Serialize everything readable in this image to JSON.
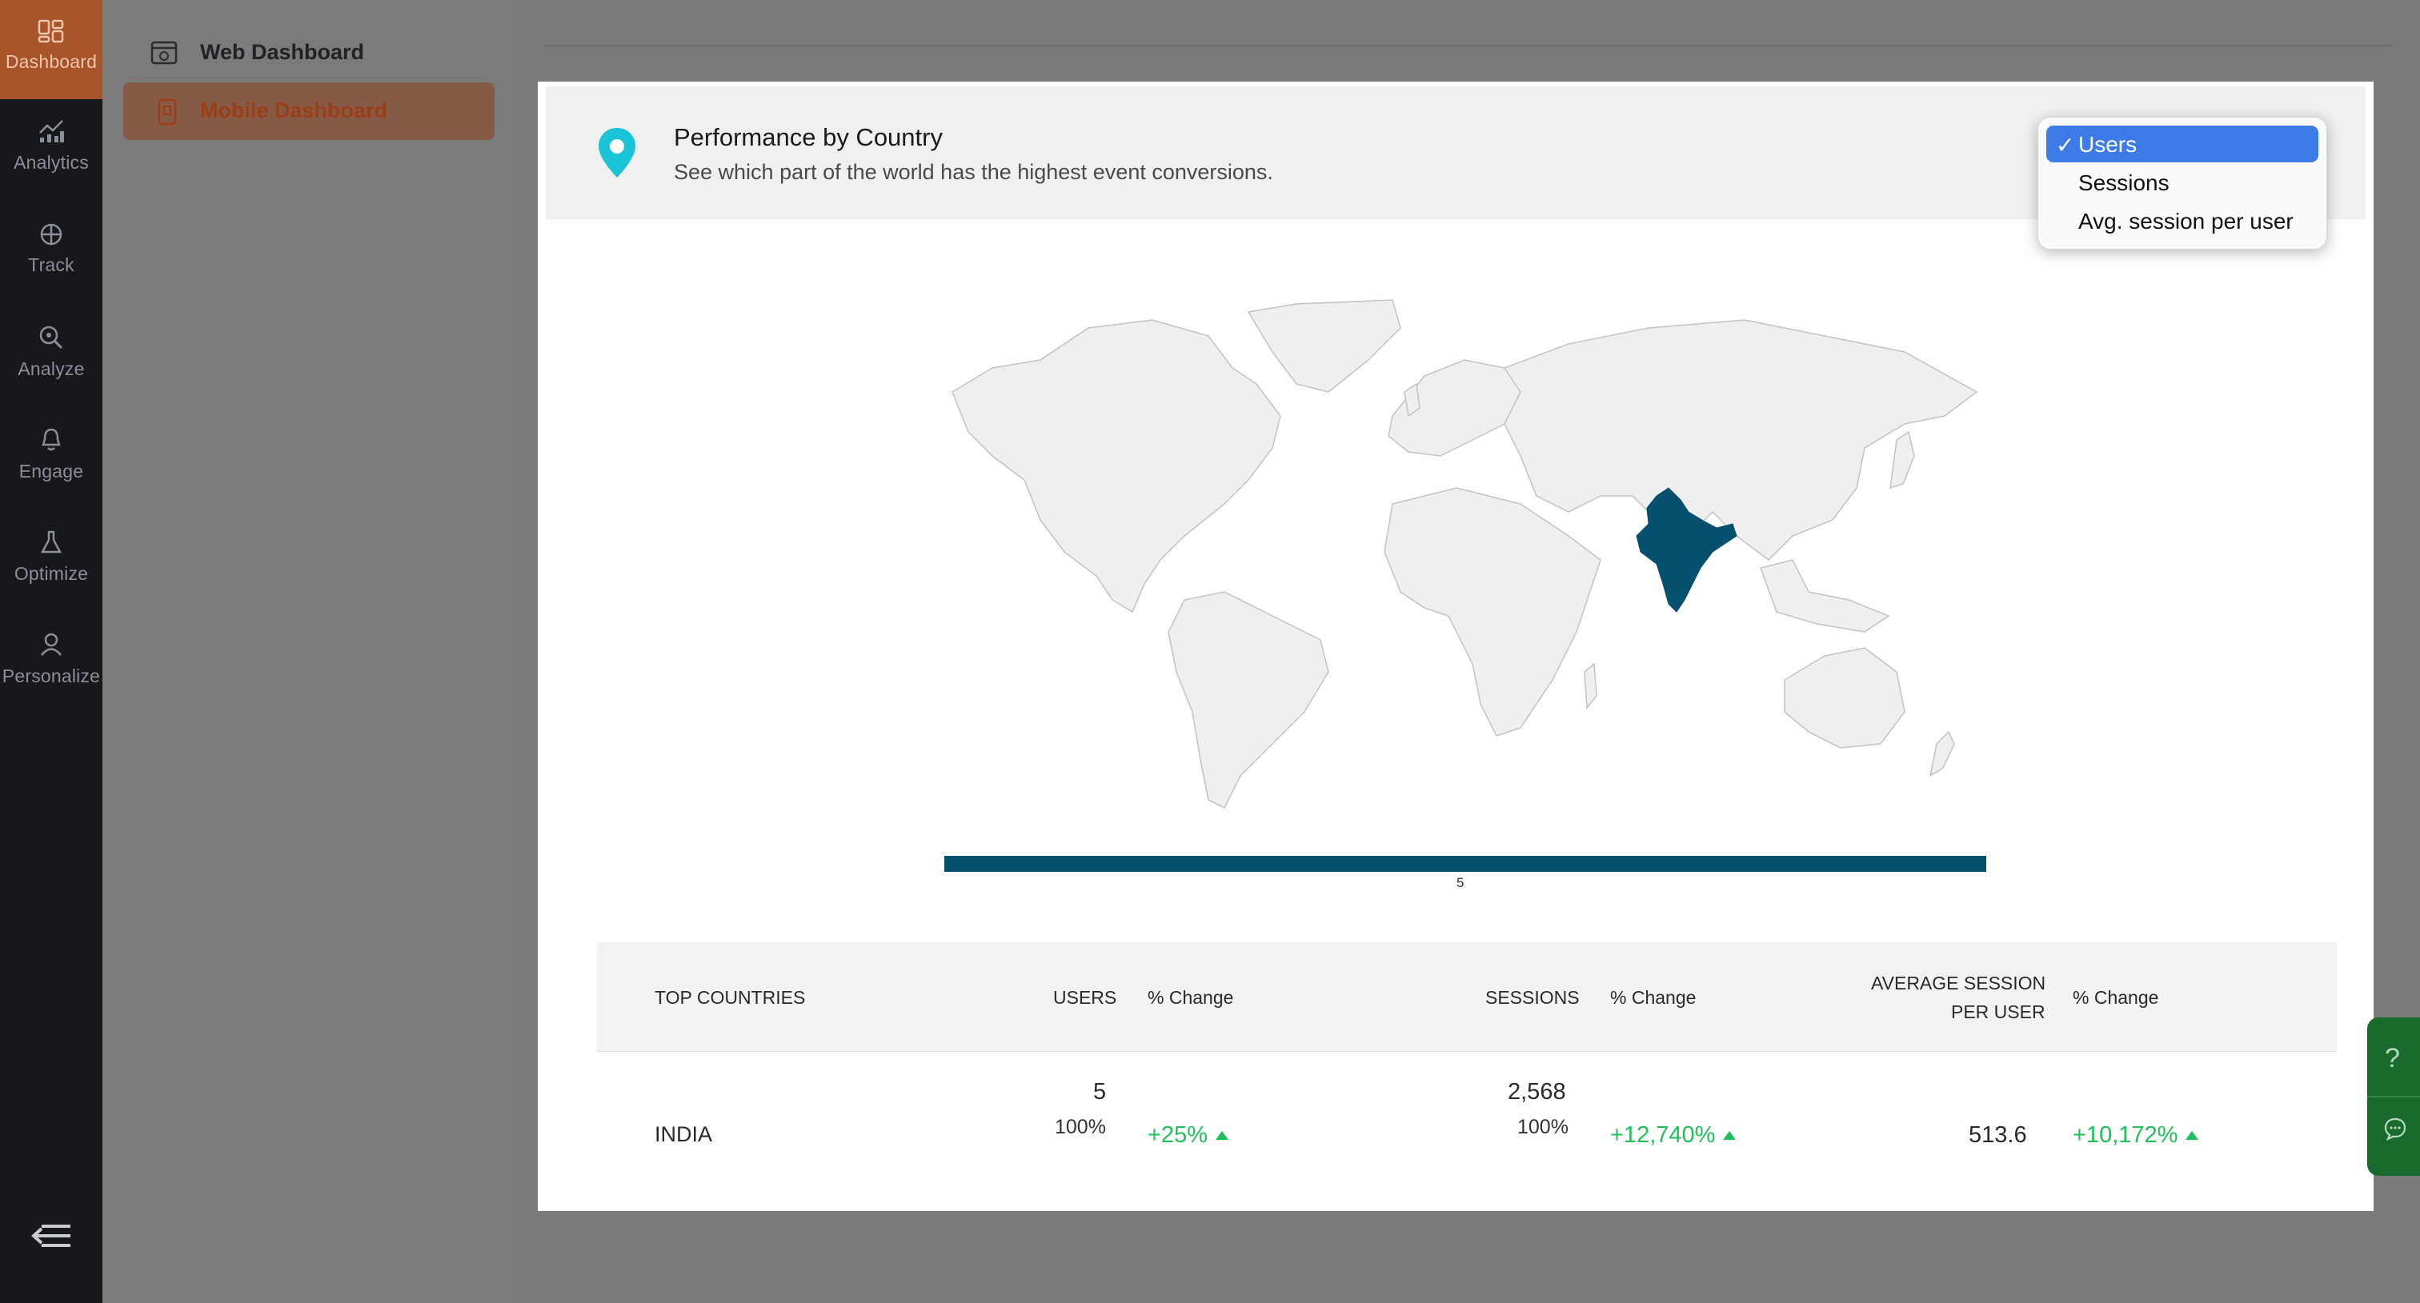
{
  "rail": {
    "items": [
      {
        "label": "Dashboard",
        "icon": "dashboard-icon",
        "active": true
      },
      {
        "label": "Analytics",
        "icon": "analytics-icon"
      },
      {
        "label": "Track",
        "icon": "track-icon"
      },
      {
        "label": "Analyze",
        "icon": "analyze-icon"
      },
      {
        "label": "Engage",
        "icon": "bell-icon"
      },
      {
        "label": "Optimize",
        "icon": "flask-icon"
      },
      {
        "label": "Personalize",
        "icon": "user-icon"
      }
    ]
  },
  "submenu": {
    "web": "Web Dashboard",
    "mobile": "Mobile Dashboard"
  },
  "card": {
    "title": "Performance by Country",
    "subtitle": "See which part of the world has the highest event conversions."
  },
  "dropdown": {
    "options": [
      "Users",
      "Sessions",
      "Avg. session per user"
    ],
    "selected": "Users",
    "check": "✓"
  },
  "map": {
    "highlighted_country": "India",
    "highlight_color": "#06506f",
    "legend_value": "5"
  },
  "table": {
    "headers": {
      "country": "TOP COUNTRIES",
      "users": "USERS",
      "users_change": "% Change",
      "sessions": "SESSIONS",
      "sessions_change": "% Change",
      "avg_line1": "AVERAGE SESSION",
      "avg_line2": "PER USER",
      "avg_change": "% Change"
    },
    "rows": [
      {
        "country": "INDIA",
        "users": "5",
        "users_share": "100%",
        "users_change": "+25%",
        "sessions": "2,568",
        "sessions_share": "100%",
        "sessions_change": "+12,740%",
        "avg": "513.6",
        "avg_change": "+10,172%"
      }
    ]
  },
  "help": {
    "question": "?"
  },
  "colors": {
    "accent": "#a8532a",
    "positive": "#1fbf5a",
    "select": "#3d7ce8"
  }
}
